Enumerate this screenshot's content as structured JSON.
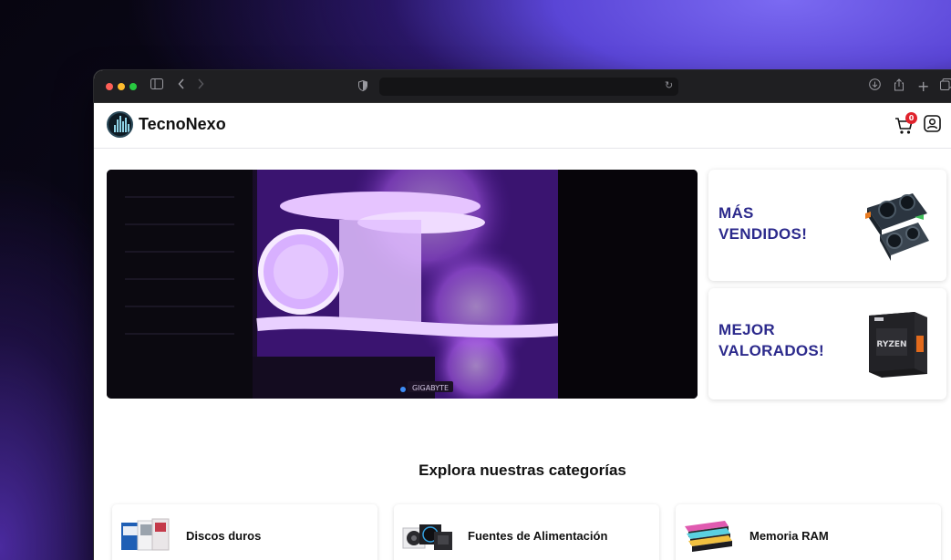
{
  "browser": {
    "url": ""
  },
  "header": {
    "brand": "TecnoNexo",
    "cart_count": "0"
  },
  "hero": {
    "image": "pc-build-purple-lighting",
    "gpu_label": "GIGABYTE"
  },
  "promos": [
    {
      "line1": "MÁS",
      "line2": "VENDIDOS!",
      "image": "graphics-card"
    },
    {
      "line1": "MEJOR",
      "line2": "VALORADOS!",
      "image": "ryzen-cpu-box"
    }
  ],
  "categories": {
    "title": "Explora nuestras categorías",
    "items": [
      {
        "label": "Discos duros",
        "icon": "hard-drive"
      },
      {
        "label": "Fuentes de Alimentación",
        "icon": "power-supply"
      },
      {
        "label": "Memoria RAM",
        "icon": "ram-modules"
      }
    ]
  },
  "colors": {
    "promo_text": "#2c2a8c",
    "badge": "#e0222c",
    "accent_dot": "#3d8cf5"
  }
}
